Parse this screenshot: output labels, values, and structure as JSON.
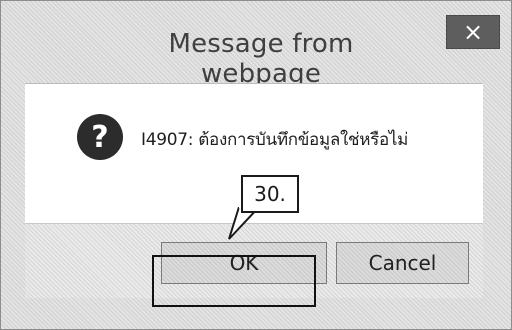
{
  "dialog": {
    "title": "Message from webpage",
    "close_label": "×",
    "message": "I4907: ต้องการบันทึกข้อมูลใช่หรือไม่",
    "icon": "question-icon",
    "buttons": {
      "ok_label": "OK",
      "cancel_label": "Cancel"
    }
  },
  "annotation": {
    "callout_label": "30."
  },
  "colors": {
    "close_button": "#5e5e5e",
    "content_background": "#ffffff",
    "annotation": "#111111"
  }
}
